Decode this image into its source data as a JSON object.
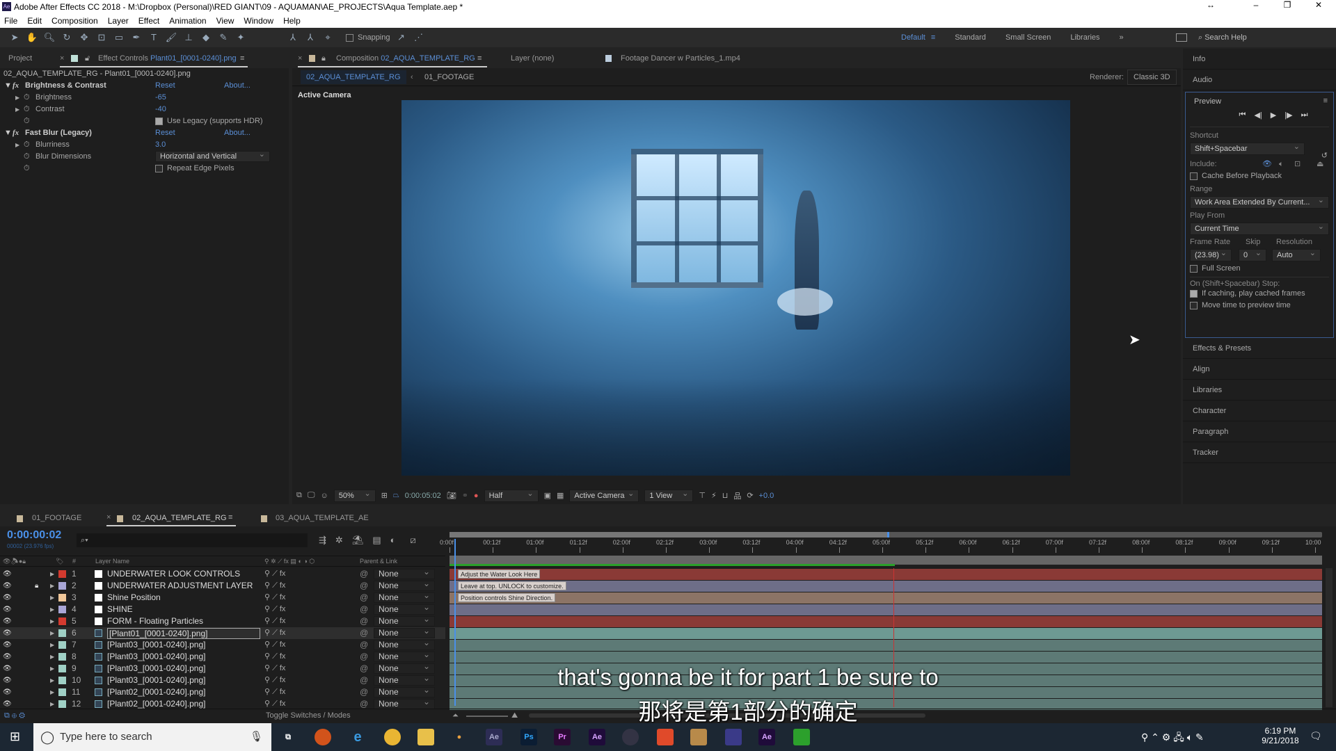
{
  "window": {
    "title": "Adobe After Effects CC 2018 - M:\\Dropbox (Personal)\\RED GIANT\\09 - AQUAMAN\\AE_PROJECTS\\Aqua Template.aep *"
  },
  "menu": [
    "File",
    "Edit",
    "Composition",
    "Layer",
    "Effect",
    "Animation",
    "View",
    "Window",
    "Help"
  ],
  "toolbar": {
    "snapping": "Snapping",
    "workspaces": [
      "Default",
      "Standard",
      "Small Screen",
      "Libraries"
    ],
    "active_workspace": "Default",
    "search_placeholder": "Search Help"
  },
  "left_panel": {
    "tab_project": "Project",
    "tab_effect_controls": "Effect Controls",
    "effect_layer": "Plant01_[0001-0240].png",
    "breadcrumb": "02_AQUA_TEMPLATE_RG - Plant01_[0001-0240].png",
    "effects": [
      {
        "name": "Brightness & Contrast",
        "reset": "Reset",
        "about": "About...",
        "props": [
          {
            "name": "Brightness",
            "value": "-65"
          },
          {
            "name": "Contrast",
            "value": "-40"
          }
        ],
        "checkbox": {
          "label": "Use Legacy (supports HDR)",
          "checked": true
        }
      },
      {
        "name": "Fast Blur (Legacy)",
        "reset": "Reset",
        "about": "About...",
        "props": [
          {
            "name": "Blurriness",
            "value": "3.0"
          }
        ],
        "dropdown": {
          "name": "Blur Dimensions",
          "value": "Horizontal and Vertical"
        },
        "checkbox": {
          "label": "Repeat Edge Pixels",
          "checked": false
        }
      }
    ]
  },
  "comp_panel": {
    "tab_comp_prefix": "Composition",
    "tab_comp": "02_AQUA_TEMPLATE_RG",
    "tab_layer": "Layer (none)",
    "tab_footage": "Footage  Dancer w Particles_1.mp4",
    "crumbs": [
      "02_AQUA_TEMPLATE_RG",
      "01_FOOTAGE"
    ],
    "renderer_label": "Renderer:",
    "renderer": "Classic 3D",
    "view_label": "Active Camera",
    "bottom": {
      "zoom": "50%",
      "timecode": "0:00:05:02",
      "resolution": "Half",
      "camera": "Active Camera",
      "views": "1 View",
      "exposure": "+0.0"
    }
  },
  "right_panel": {
    "items_top": [
      "Info",
      "Audio"
    ],
    "preview": {
      "title": "Preview",
      "shortcut_label": "Shortcut",
      "shortcut": "Shift+Spacebar",
      "include_label": "Include:",
      "cache_before": "Cache Before Playback",
      "range_label": "Range",
      "range": "Work Area Extended By Current...",
      "play_from_label": "Play From",
      "play_from": "Current Time",
      "frame_rate_label": "Frame Rate",
      "skip_label": "Skip",
      "resolution_label": "Resolution",
      "frame_rate": "(23.98)",
      "skip": "0",
      "resolution": "Auto",
      "full_screen": "Full Screen",
      "stop_label": "On (Shift+Spacebar) Stop:",
      "if_caching": "If caching, play cached frames",
      "move_time": "Move time to preview time"
    },
    "items_bottom": [
      "Effects & Presets",
      "Align",
      "Libraries",
      "Character",
      "Paragraph",
      "Tracker"
    ]
  },
  "timeline": {
    "tabs": [
      "01_FOOTAGE",
      "02_AQUA_TEMPLATE_RG",
      "03_AQUA_TEMPLATE_AE"
    ],
    "active_tab": "02_AQUA_TEMPLATE_RG",
    "timecode": "0:00:00:02",
    "frame_info": "00002 (23.976 fps)",
    "col_layer_name": "Layer Name",
    "col_parent": "Parent & Link",
    "toggle": "Toggle Switches / Modes",
    "ruler": [
      "0:00f",
      "00:12f",
      "01:00f",
      "01:12f",
      "02:00f",
      "02:12f",
      "03:00f",
      "03:12f",
      "04:00f",
      "04:12f",
      "05:00f",
      "05:12f",
      "06:00f",
      "06:12f",
      "07:00f",
      "07:12f",
      "08:00f",
      "08:12f",
      "09:00f",
      "09:12f",
      "10:00"
    ],
    "layers": [
      {
        "num": "1",
        "name": "UNDERWATER LOOK CONTROLS",
        "label": "#d33a2f",
        "parent": "None",
        "bar": "#8a3a36",
        "comment": "Adjust the Water Look Here"
      },
      {
        "num": "2",
        "name": "UNDERWATER ADJUSTMENT LAYER",
        "label": "#a9a6d6",
        "parent": "None",
        "bar": "#6e6e88",
        "comment": "Leave at top. UNLOCK to customize.",
        "locked": true
      },
      {
        "num": "3",
        "name": "Shine Position",
        "label": "#f0c79a",
        "parent": "None",
        "bar": "#8c7466",
        "comment": "Position controls Shine Direction."
      },
      {
        "num": "4",
        "name": "SHINE",
        "label": "#a9a6d6",
        "parent": "None",
        "bar": "#6e6e88"
      },
      {
        "num": "5",
        "name": "FORM - Floating Particles",
        "label": "#d33a2f",
        "parent": "None",
        "bar": "#8a3a36"
      },
      {
        "num": "6",
        "name": "[Plant01_[0001-0240].png]",
        "label": "#9fd0c5",
        "parent": "None",
        "bar": "#6d9a93",
        "selected": true
      },
      {
        "num": "7",
        "name": "[Plant03_[0001-0240].png]",
        "label": "#9fd0c5",
        "parent": "None",
        "bar": "#5d7a76"
      },
      {
        "num": "8",
        "name": "[Plant03_[0001-0240].png]",
        "label": "#9fd0c5",
        "parent": "None",
        "bar": "#5d7a76"
      },
      {
        "num": "9",
        "name": "[Plant03_[0001-0240].png]",
        "label": "#9fd0c5",
        "parent": "None",
        "bar": "#5d7a76"
      },
      {
        "num": "10",
        "name": "[Plant03_[0001-0240].png]",
        "label": "#9fd0c5",
        "parent": "None",
        "bar": "#5d7a76"
      },
      {
        "num": "11",
        "name": "[Plant02_[0001-0240].png]",
        "label": "#9fd0c5",
        "parent": "None",
        "bar": "#5d7a76"
      },
      {
        "num": "12",
        "name": "[Plant02_[0001-0240].png]",
        "label": "#9fd0c5",
        "parent": "None",
        "bar": "#5d7a76"
      }
    ]
  },
  "subtitles": {
    "en": "that's gonna be it for part 1 be sure to",
    "zh": "那将是第1部分的确定"
  },
  "taskbar": {
    "search_placeholder": "Type here to search",
    "time": "6:19 PM",
    "date": "9/21/2018"
  }
}
